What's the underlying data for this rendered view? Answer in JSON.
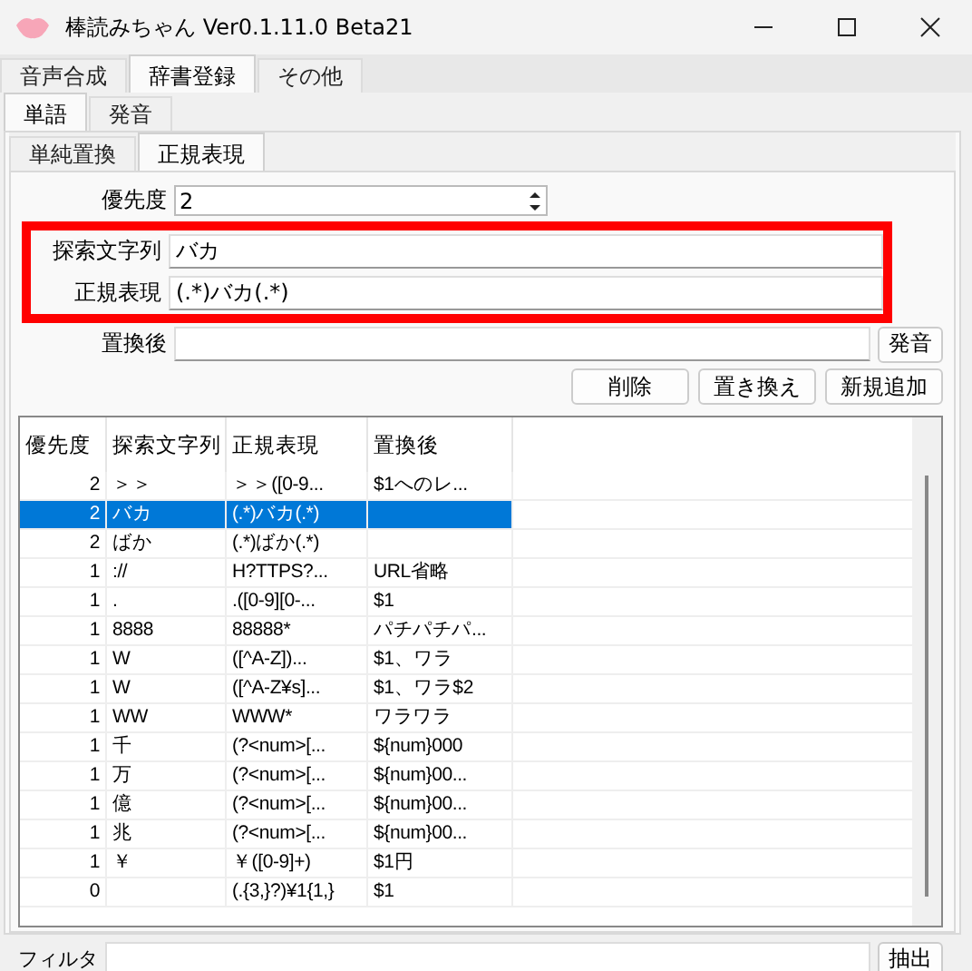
{
  "window": {
    "title": "棒読みちゃん Ver0.1.11.0 Beta21"
  },
  "tabs": [
    {
      "label": "音声合成",
      "selected": false
    },
    {
      "label": "辞書登録",
      "selected": true
    },
    {
      "label": "その他",
      "selected": false
    }
  ],
  "subtabs": [
    {
      "label": "単語",
      "selected": true
    },
    {
      "label": "発音",
      "selected": false
    }
  ],
  "inner_tabs": [
    {
      "label": "単純置換",
      "selected": false
    },
    {
      "label": "正規表現",
      "selected": true
    }
  ],
  "form": {
    "priority_label": "優先度",
    "priority": "2",
    "search_label": "探索文字列",
    "search": "バカ",
    "regex_label": "正規表現",
    "regex": "(.*)バカ(.*)",
    "replace_label": "置換後",
    "pronounce_button": "発音"
  },
  "buttons": [
    "削除",
    "置き換え",
    "新規追加"
  ],
  "table": {
    "columns": [
      "優先度",
      "探索文字列",
      "正規表現",
      "置換後"
    ],
    "rows": [
      {
        "cells": [
          "2",
          "＞＞",
          "＞＞([0-9...",
          "$1へのレ..."
        ],
        "selected": false
      },
      {
        "cells": [
          "2",
          "バカ",
          "(.*)バカ(.*)",
          ""
        ],
        "selected": true
      },
      {
        "cells": [
          "2",
          "ばか",
          "(.*)ばか(.*)",
          ""
        ],
        "selected": false
      },
      {
        "cells": [
          "1",
          "://",
          "H?TTPS?...",
          "URL省略"
        ],
        "selected": false
      },
      {
        "cells": [
          "1",
          ".",
          ".([0-9][0-...",
          "$1"
        ],
        "selected": false
      },
      {
        "cells": [
          "1",
          "8888",
          "88888*",
          "パチパチパ..."
        ],
        "selected": false
      },
      {
        "cells": [
          "1",
          "W",
          "([^A-Z])...",
          "$1、ワラ"
        ],
        "selected": false
      },
      {
        "cells": [
          "1",
          "W",
          "([^A-Z¥s]...",
          "$1、ワラ$2"
        ],
        "selected": false
      },
      {
        "cells": [
          "1",
          "WW",
          "WWW*",
          "ワラワラ"
        ],
        "selected": false
      },
      {
        "cells": [
          "1",
          "千",
          "(?<num>[...",
          "${num}000"
        ],
        "selected": false
      },
      {
        "cells": [
          "1",
          "万",
          "(?<num>[...",
          "${num}00..."
        ],
        "selected": false
      },
      {
        "cells": [
          "1",
          "億",
          "(?<num>[...",
          "${num}00..."
        ],
        "selected": false
      },
      {
        "cells": [
          "1",
          "兆",
          "(?<num>[...",
          "${num}00..."
        ],
        "selected": false
      },
      {
        "cells": [
          "1",
          "￥",
          "￥([0-9]+)",
          "$1円"
        ],
        "selected": false
      },
      {
        "cells": [
          "0",
          "",
          "(.{3,}?)¥1{1,}",
          "$1"
        ],
        "selected": false
      }
    ]
  },
  "filter": {
    "label": "フィルタ",
    "button": "抽出"
  }
}
